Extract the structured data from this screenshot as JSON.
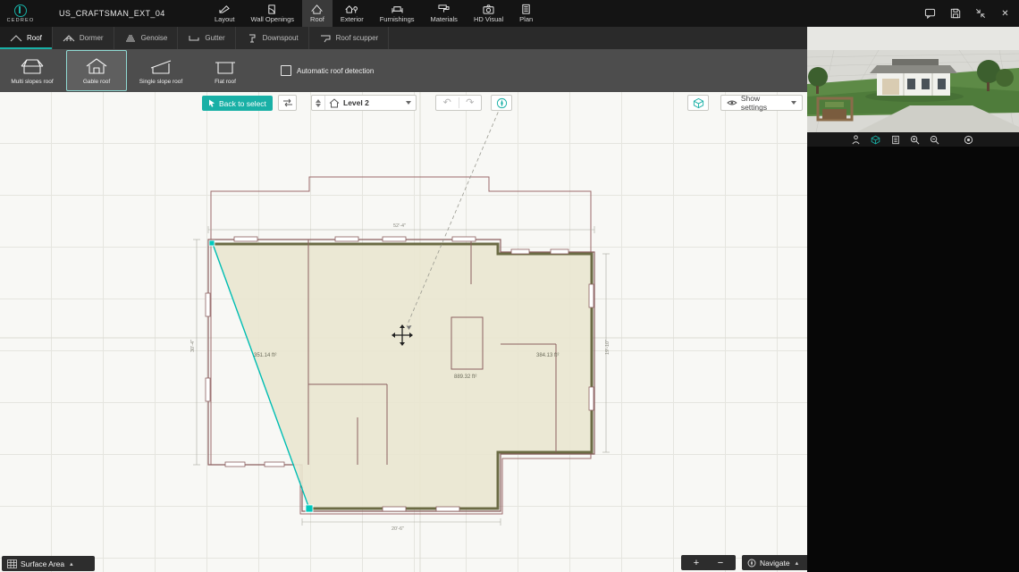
{
  "app": {
    "brand": "CEDREO",
    "project_name": "US_CRAFTSMAN_EXT_04"
  },
  "main_nav": {
    "items": [
      {
        "label": "Layout"
      },
      {
        "label": "Wall Openings"
      },
      {
        "label": "Roof"
      },
      {
        "label": "Exterior"
      },
      {
        "label": "Furnishings"
      },
      {
        "label": "Materials"
      },
      {
        "label": "HD Visual"
      },
      {
        "label": "Plan"
      }
    ],
    "active": "Roof"
  },
  "ribbon": {
    "tabs": [
      {
        "label": "Roof"
      },
      {
        "label": "Dormer"
      },
      {
        "label": "Genoise"
      },
      {
        "label": "Gutter"
      },
      {
        "label": "Downspout"
      },
      {
        "label": "Roof scupper"
      }
    ],
    "active": "Roof"
  },
  "roof_tools": {
    "buttons": [
      {
        "label": "Multi slopes roof"
      },
      {
        "label": "Gable roof"
      },
      {
        "label": "Single slope roof"
      },
      {
        "label": "Flat roof"
      }
    ],
    "active": "Gable roof",
    "auto_detect_label": "Automatic roof detection",
    "auto_detect_checked": false
  },
  "canvas_toolbar": {
    "back_to_select": "Back to select",
    "level_value": "Level 2",
    "show_settings": "Show settings"
  },
  "plan": {
    "area_labels": [
      {
        "text": "351.14 ft²"
      },
      {
        "text": "889.32 ft²"
      },
      {
        "text": "384.13 ft²"
      }
    ],
    "dimension_labels": {
      "top": "52'-4\"",
      "left": "30'-4\"",
      "bottom": "20'-6\"",
      "right": "19'-10\""
    }
  },
  "bottom_bar": {
    "surface_area": "Surface Area",
    "navigate": "Navigate",
    "zoom_in": "+",
    "zoom_out": "−"
  },
  "icons": {
    "close": "✕",
    "undo": "↶",
    "redo": "↷",
    "caret_up": "▴"
  },
  "colors": {
    "accent_teal": "#19b0a6",
    "plan_fill": "#e9e6d0",
    "selected_wall": "#6b6b44",
    "roof_outline": "#9b6a6a"
  }
}
